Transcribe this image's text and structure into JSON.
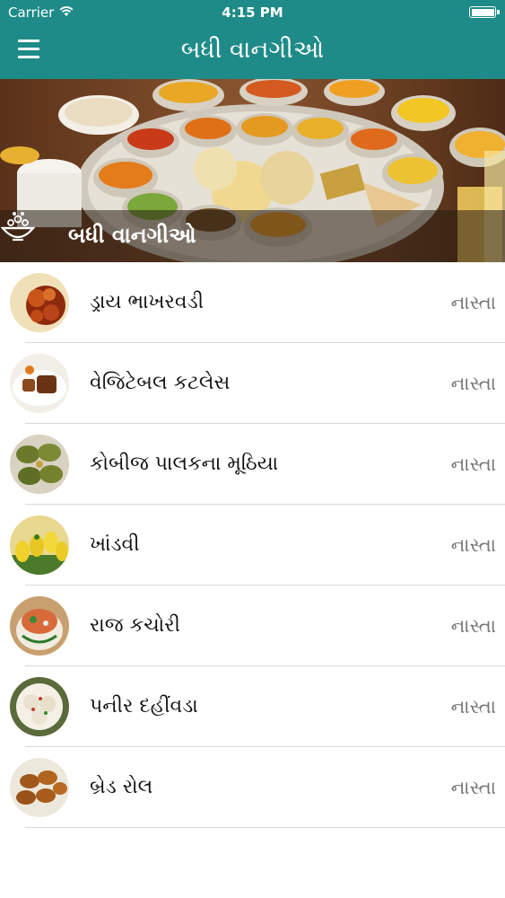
{
  "status_bar": {
    "carrier": "Carrier",
    "time": "4:15 PM"
  },
  "nav": {
    "title": "બધી વાનગીઓ",
    "menu_icon": "hamburger-menu-icon"
  },
  "hero": {
    "caption": "બધી વાનગીઓ",
    "icon": "food-bowl-icon"
  },
  "recipes": [
    {
      "name": "ડ્રાય ભાખરવડી",
      "category": "નાસ્તા"
    },
    {
      "name": "વેજિટેબલ કટલેસ",
      "category": "નાસ્તા"
    },
    {
      "name": "કોબીજ પાલકના મૂઠિયા",
      "category": "નાસ્તા"
    },
    {
      "name": "ખાંડવી",
      "category": "નાસ્તા"
    },
    {
      "name": "રાજ કચોરી",
      "category": "નાસ્તા"
    },
    {
      "name": "પનીર દહીંવડા",
      "category": "નાસ્તા"
    },
    {
      "name": "બ્રેડ રોલ",
      "category": "નાસ્તા"
    }
  ],
  "colors": {
    "header": "#1f8b88",
    "divider": "#d8d8d8",
    "category_text": "#777777"
  }
}
